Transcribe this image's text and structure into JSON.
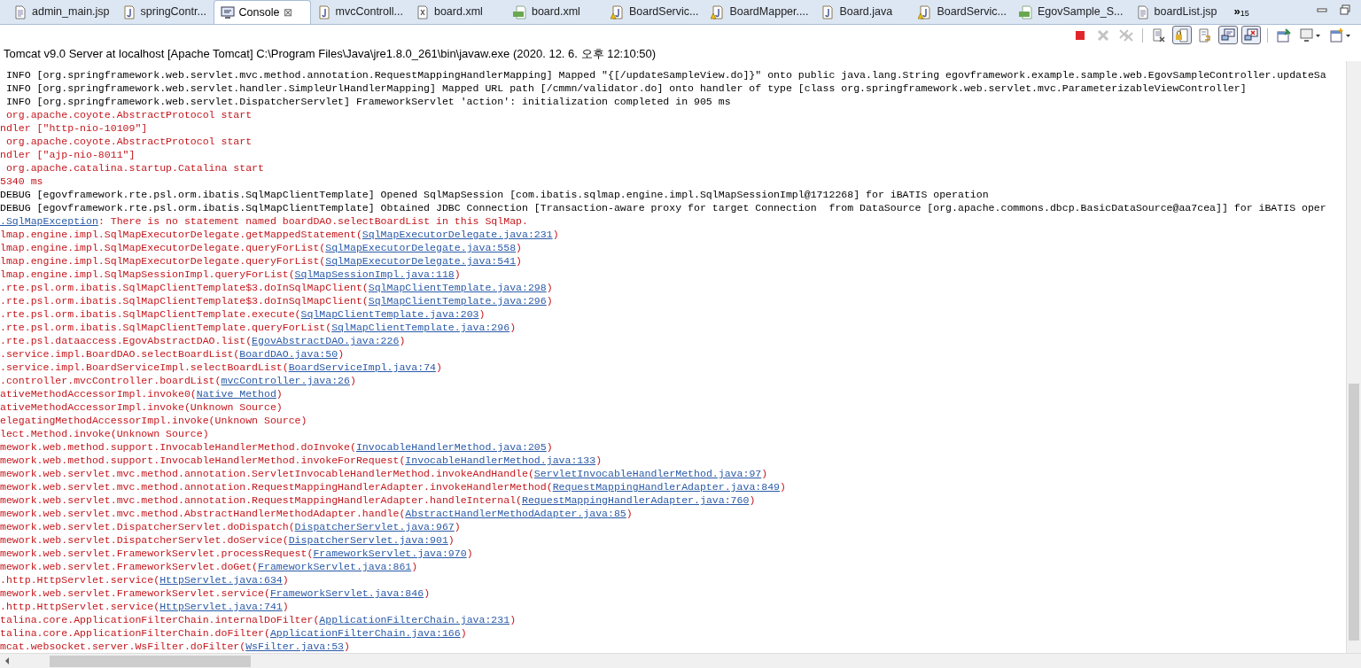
{
  "tabs": [
    {
      "label": "admin_main.jsp",
      "kind": "jsp",
      "selected": false
    },
    {
      "label": "springContr...",
      "kind": "java",
      "selected": false
    },
    {
      "label": "Console",
      "kind": "console",
      "selected": true,
      "close": "⊠"
    },
    {
      "label": "mvcControll...",
      "kind": "java",
      "selected": false
    },
    {
      "label": "board.xml",
      "kind": "xml",
      "selected": false
    },
    {
      "label": "board.xml",
      "kind": "map",
      "selected": false
    },
    {
      "label": "BoardServic...",
      "kind": "java-warning",
      "selected": false
    },
    {
      "label": "BoardMapper....",
      "kind": "java-warning",
      "selected": false
    },
    {
      "label": "Board.java",
      "kind": "java",
      "selected": false
    },
    {
      "label": "BoardServic...",
      "kind": "java-warning",
      "selected": false
    },
    {
      "label": "EgovSample_S...",
      "kind": "map",
      "selected": false
    },
    {
      "label": "boardList.jsp",
      "kind": "jsp",
      "selected": false
    }
  ],
  "overflow": {
    "label": "»",
    "count": "15"
  },
  "toolbar": [
    {
      "kind": "terminate",
      "disabled": false,
      "pressed": false
    },
    {
      "kind": "remove",
      "disabled": true,
      "pressed": false
    },
    {
      "kind": "remove-all",
      "disabled": true,
      "pressed": false
    },
    {
      "kind": "clear",
      "disabled": false,
      "pressed": false
    },
    {
      "kind": "scroll-lock",
      "disabled": false,
      "pressed": true
    },
    {
      "kind": "word-wrap",
      "disabled": false,
      "pressed": false
    },
    {
      "kind": "show-out",
      "disabled": false,
      "pressed": true
    },
    {
      "kind": "show-err",
      "disabled": false,
      "pressed": true
    },
    {
      "kind": "pin",
      "disabled": false,
      "pressed": false
    },
    {
      "kind": "display",
      "disabled": false,
      "pressed": false
    },
    {
      "kind": "open-console",
      "disabled": false,
      "pressed": false
    }
  ],
  "console_title": "Tomcat v9.0 Server at localhost [Apache Tomcat] C:\\Program Files\\Java\\jre1.8.0_261\\bin\\javaw.exe (2020. 12. 6. 오후 12:10:50)",
  "lines": [
    {
      "kind": "info",
      "text": " INFO [org.springframework.web.servlet.mvc.method.annotation.RequestMappingHandlerMapping] Mapped \"{[/updateSampleView.do]}\" onto public java.lang.String egovframework.example.sample.web.EgovSampleController.updateSa"
    },
    {
      "kind": "info",
      "text": " INFO [org.springframework.web.servlet.handler.SimpleUrlHandlerMapping] Mapped URL path [/cmmn/validator.do] onto handler of type [class org.springframework.web.servlet.mvc.ParameterizableViewController]"
    },
    {
      "kind": "info",
      "text": " INFO [org.springframework.web.servlet.DispatcherServlet] FrameworkServlet 'action': initialization completed in 905 ms"
    },
    {
      "kind": "error",
      "text": " org.apache.coyote.AbstractProtocol start"
    },
    {
      "kind": "error",
      "text": "ndler [\"http-nio-10109\"]"
    },
    {
      "kind": "error",
      "text": " org.apache.coyote.AbstractProtocol start"
    },
    {
      "kind": "error",
      "text": "ndler [\"ajp-nio-8011\"]"
    },
    {
      "kind": "error",
      "text": " org.apache.catalina.startup.Catalina start"
    },
    {
      "kind": "error",
      "text": "5340 ms"
    },
    {
      "kind": "info",
      "text": "DEBUG [egovframework.rte.psl.orm.ibatis.SqlMapClientTemplate] Opened SqlMapSession [com.ibatis.sqlmap.engine.impl.SqlMapSessionImpl@1712268] for iBATIS operation"
    },
    {
      "kind": "info",
      "text": "DEBUG [egovframework.rte.psl.orm.ibatis.SqlMapClientTemplate] Obtained JDBC Connection [Transaction-aware proxy for target Connection  from DataSource [org.apache.commons.dbcp.BasicDataSource@aa7cea]] for iBATIS oper"
    },
    {
      "kind": "exception",
      "link": ".SqlMapException",
      "text": ": There is no statement named boardDAO.selectBoardList in this SqlMap."
    },
    {
      "kind": "error",
      "text": "lmap.engine.impl.SqlMapExecutorDelegate.getMappedStatement(",
      "link": "SqlMapExecutorDelegate.java:231",
      "suffix": ")"
    },
    {
      "kind": "error",
      "text": "lmap.engine.impl.SqlMapExecutorDelegate.queryForList(",
      "link": "SqlMapExecutorDelegate.java:558",
      "suffix": ")"
    },
    {
      "kind": "error",
      "text": "lmap.engine.impl.SqlMapExecutorDelegate.queryForList(",
      "link": "SqlMapExecutorDelegate.java:541",
      "suffix": ")"
    },
    {
      "kind": "error",
      "text": "lmap.engine.impl.SqlMapSessionImpl.queryForList(",
      "link": "SqlMapSessionImpl.java:118",
      "suffix": ")"
    },
    {
      "kind": "error",
      "text": ".rte.psl.orm.ibatis.SqlMapClientTemplate$3.doInSqlMapClient(",
      "link": "SqlMapClientTemplate.java:298",
      "suffix": ")"
    },
    {
      "kind": "error",
      "text": ".rte.psl.orm.ibatis.SqlMapClientTemplate$3.doInSqlMapClient(",
      "link": "SqlMapClientTemplate.java:296",
      "suffix": ")"
    },
    {
      "kind": "error",
      "text": ".rte.psl.orm.ibatis.SqlMapClientTemplate.execute(",
      "link": "SqlMapClientTemplate.java:203",
      "suffix": ")"
    },
    {
      "kind": "error",
      "text": ".rte.psl.orm.ibatis.SqlMapClientTemplate.queryForList(",
      "link": "SqlMapClientTemplate.java:296",
      "suffix": ")"
    },
    {
      "kind": "error",
      "text": ".rte.psl.dataaccess.EgovAbstractDAO.list(",
      "link": "EgovAbstractDAO.java:226",
      "suffix": ")"
    },
    {
      "kind": "error",
      "text": ".service.impl.BoardDAO.selectBoardList(",
      "link": "BoardDAO.java:50",
      "suffix": ")"
    },
    {
      "kind": "error",
      "text": ".service.impl.BoardServiceImpl.selectBoardList(",
      "link": "BoardServiceImpl.java:74",
      "suffix": ")"
    },
    {
      "kind": "error",
      "text": ".controller.mvcController.boardList(",
      "link": "mvcController.java:26",
      "suffix": ")"
    },
    {
      "kind": "error",
      "text": "ativeMethodAccessorImpl.invoke0(",
      "link": "Native Method",
      "suffix": ")"
    },
    {
      "kind": "error",
      "text": "ativeMethodAccessorImpl.invoke(Unknown Source)"
    },
    {
      "kind": "error",
      "text": "elegatingMethodAccessorImpl.invoke(Unknown Source)"
    },
    {
      "kind": "error",
      "text": "lect.Method.invoke(Unknown Source)"
    },
    {
      "kind": "error",
      "text": "mework.web.method.support.InvocableHandlerMethod.doInvoke(",
      "link": "InvocableHandlerMethod.java:205",
      "suffix": ")"
    },
    {
      "kind": "error",
      "text": "mework.web.method.support.InvocableHandlerMethod.invokeForRequest(",
      "link": "InvocableHandlerMethod.java:133",
      "suffix": ")"
    },
    {
      "kind": "error",
      "text": "mework.web.servlet.mvc.method.annotation.ServletInvocableHandlerMethod.invokeAndHandle(",
      "link": "ServletInvocableHandlerMethod.java:97",
      "suffix": ")"
    },
    {
      "kind": "error",
      "text": "mework.web.servlet.mvc.method.annotation.RequestMappingHandlerAdapter.invokeHandlerMethod(",
      "link": "RequestMappingHandlerAdapter.java:849",
      "suffix": ")"
    },
    {
      "kind": "error",
      "text": "mework.web.servlet.mvc.method.annotation.RequestMappingHandlerAdapter.handleInternal(",
      "link": "RequestMappingHandlerAdapter.java:760",
      "suffix": ")"
    },
    {
      "kind": "error",
      "text": "mework.web.servlet.mvc.method.AbstractHandlerMethodAdapter.handle(",
      "link": "AbstractHandlerMethodAdapter.java:85",
      "suffix": ")"
    },
    {
      "kind": "error",
      "text": "mework.web.servlet.DispatcherServlet.doDispatch(",
      "link": "DispatcherServlet.java:967",
      "suffix": ")"
    },
    {
      "kind": "error",
      "text": "mework.web.servlet.DispatcherServlet.doService(",
      "link": "DispatcherServlet.java:901",
      "suffix": ")"
    },
    {
      "kind": "error",
      "text": "mework.web.servlet.FrameworkServlet.processRequest(",
      "link": "FrameworkServlet.java:970",
      "suffix": ")"
    },
    {
      "kind": "error",
      "text": "mework.web.servlet.FrameworkServlet.doGet(",
      "link": "FrameworkServlet.java:861",
      "suffix": ")"
    },
    {
      "kind": "error",
      "text": ".http.HttpServlet.service(",
      "link": "HttpServlet.java:634",
      "suffix": ")"
    },
    {
      "kind": "error",
      "text": "mework.web.servlet.FrameworkServlet.service(",
      "link": "FrameworkServlet.java:846",
      "suffix": ")"
    },
    {
      "kind": "error",
      "text": ".http.HttpServlet.service(",
      "link": "HttpServlet.java:741",
      "suffix": ")"
    },
    {
      "kind": "error",
      "text": "talina.core.ApplicationFilterChain.internalDoFilter(",
      "link": "ApplicationFilterChain.java:231",
      "suffix": ")"
    },
    {
      "kind": "error",
      "text": "talina.core.ApplicationFilterChain.doFilter(",
      "link": "ApplicationFilterChain.java:166",
      "suffix": ")"
    },
    {
      "kind": "error",
      "text": "mcat.websocket.server.WsFilter.doFilter(",
      "link": "WsFilter.java:53",
      "suffix": ")"
    }
  ]
}
